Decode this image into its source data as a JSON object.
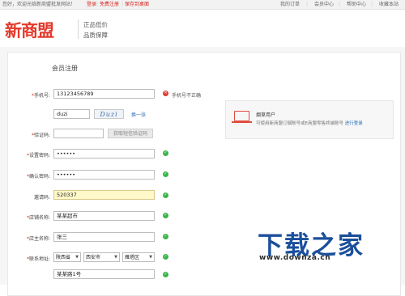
{
  "topbar": {
    "welcome": "您好，欢迎光临新商盟批发网站！",
    "login": "登录",
    "register": "免费注册",
    "save_desktop": "保存到桌面",
    "nav": [
      "我的订单",
      "会员中心",
      "帮助中心",
      "收藏本站"
    ]
  },
  "header": {
    "logo": "新商盟",
    "slogan": [
      "正品低价",
      "品质保障"
    ]
  },
  "form": {
    "title": "会员注册",
    "phone": {
      "label": "手机号:",
      "value": "13123456789",
      "error": "手机号不正确"
    },
    "captcha": {
      "value": "duzi",
      "image_text": "Duzi",
      "refresh": "换一张"
    },
    "sms": {
      "label": "验证码:",
      "value": "",
      "button": "获取短信验证码"
    },
    "password": {
      "label": "设置密码:",
      "value": "••••••"
    },
    "confirm": {
      "label": "确认密码:",
      "value": "••••••"
    },
    "invite": {
      "label": "邀请码:",
      "value": "520337"
    },
    "store": {
      "label": "店铺名称:",
      "value": "某某超市"
    },
    "owner": {
      "label": "店主名称:",
      "value": "张三"
    },
    "address": {
      "label": "联系地址:",
      "province": "陕西省",
      "city": "西安市",
      "district": "雁塔区",
      "detail": "某某路1号"
    }
  },
  "card": {
    "title": "烟草用户",
    "text": "可使用新商盟订烟账号或E商盟零售终端账号",
    "link": "进行登录"
  },
  "watermark": {
    "name": "下载之家",
    "url": "www.downza.cn"
  }
}
